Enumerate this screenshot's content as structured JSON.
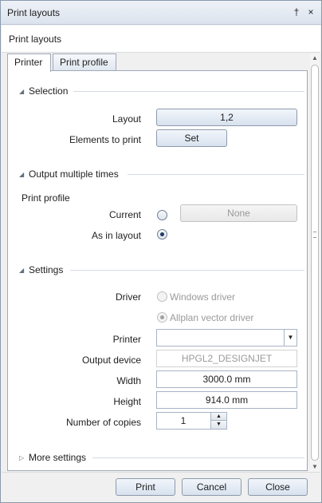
{
  "window": {
    "title": "Print layouts",
    "pin_glyph": "†",
    "close_glyph": "×"
  },
  "header": {
    "label": "Print layouts"
  },
  "tabs": [
    {
      "label": "Printer",
      "active": true
    },
    {
      "label": "Print profile",
      "active": false
    }
  ],
  "selection": {
    "title": "Selection",
    "layout_label": "Layout",
    "layout_value": "1,2",
    "elements_label": "Elements to print",
    "elements_button": "Set"
  },
  "output": {
    "title": "Output multiple times",
    "print_profile_label": "Print profile",
    "current_label": "Current",
    "current_value": "None",
    "as_in_layout_label": "As in layout"
  },
  "settings": {
    "title": "Settings",
    "driver_label": "Driver",
    "windows_driver": "Windows driver",
    "allplan_driver": "Allplan vector driver",
    "printer_label": "Printer",
    "printer_value": "",
    "output_device_label": "Output device",
    "output_device_value": "HPGL2_DESIGNJET",
    "width_label": "Width",
    "width_value": "3000.0 mm",
    "height_label": "Height",
    "height_value": "914.0 mm",
    "copies_label": "Number of copies",
    "copies_value": "1"
  },
  "more_settings": {
    "title": "More settings"
  },
  "footer": {
    "print": "Print",
    "cancel": "Cancel",
    "close": "Close"
  },
  "icons": {
    "collapse": "◢",
    "expand": "▷",
    "dropdown": "▼",
    "up": "▲",
    "down": "▼"
  }
}
